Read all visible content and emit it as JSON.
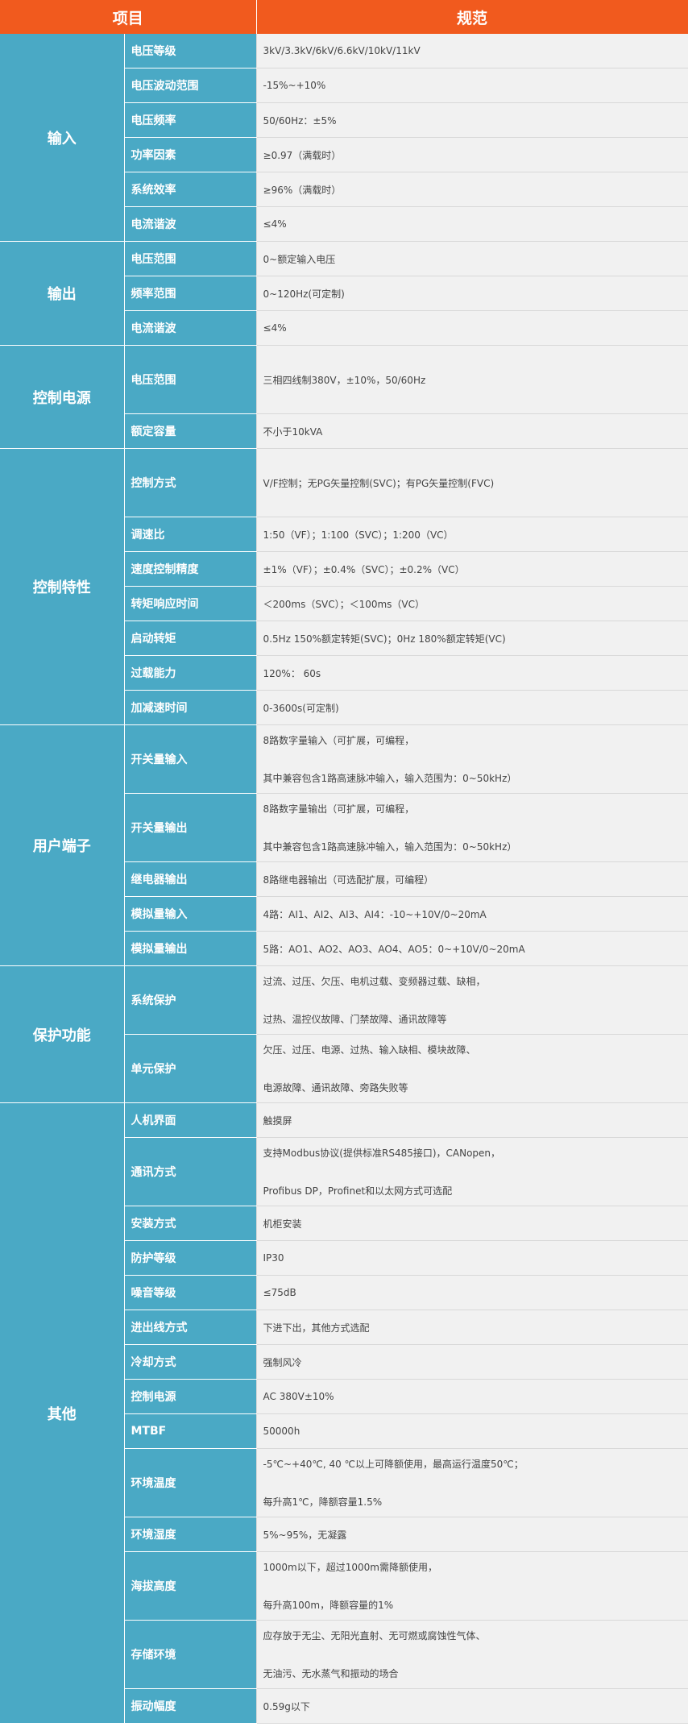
{
  "header": {
    "item": "项目",
    "spec": "规范"
  },
  "groups": [
    {
      "name": "输入",
      "rows": [
        {
          "item": "电压等级",
          "lines": [
            "3kV/3.3kV/6kV/6.6kV/10kV/11kV"
          ]
        },
        {
          "item": "电压波动范围",
          "lines": [
            "-15%~+10%"
          ]
        },
        {
          "item": "电压频率",
          "lines": [
            "50/60Hz：±5%"
          ]
        },
        {
          "item": "功率因素",
          "lines": [
            "≥0.97（满载时）"
          ]
        },
        {
          "item": "系统效率",
          "lines": [
            "≥96%（满载时）"
          ]
        },
        {
          "item": "电流谐波",
          "lines": [
            "≤4%"
          ]
        }
      ]
    },
    {
      "name": "输出",
      "rows": [
        {
          "item": "电压范围",
          "lines": [
            "0~额定输入电压"
          ]
        },
        {
          "item": "频率范围",
          "lines": [
            "0~120Hz(可定制)"
          ]
        },
        {
          "item": "电流谐波",
          "lines": [
            "≤4%"
          ]
        }
      ]
    },
    {
      "name": "控制电源",
      "rows": [
        {
          "item": "电压范围",
          "lines": [
            "三相四线制380V，±10%，50/60Hz"
          ],
          "tall": true
        },
        {
          "item": "额定容量",
          "lines": [
            "不小于10kVA"
          ]
        }
      ]
    },
    {
      "name": "控制特性",
      "rows": [
        {
          "item": "控制方式",
          "lines": [
            "V/F控制；无PG矢量控制(SVC)；有PG矢量控制(FVC)"
          ],
          "tall": true
        },
        {
          "item": "调速比",
          "lines": [
            "1:50（VF）；1:100（SVC）；1:200（VC）"
          ]
        },
        {
          "item": "速度控制精度",
          "lines": [
            "±1%（VF）；±0.4%（SVC）；±0.2%（VC）"
          ]
        },
        {
          "item": "转矩响应时间",
          "lines": [
            "＜200ms（SVC）；＜100ms（VC）"
          ]
        },
        {
          "item": "启动转矩",
          "lines": [
            "0.5Hz 150%额定转矩(SVC)；0Hz 180%额定转矩(VC)"
          ]
        },
        {
          "item": "过载能力",
          "lines": [
            "120%： 60s"
          ]
        },
        {
          "item": "加减速时间",
          "lines": [
            "0-3600s(可定制)"
          ]
        }
      ]
    },
    {
      "name": "用户端子",
      "rows": [
        {
          "item": "开关量输入",
          "lines": [
            "8路数字量输入（可扩展，可编程，",
            "其中兼容包含1路高速脉冲输入，输入范围为：0~50kHz）"
          ]
        },
        {
          "item": "开关量输出",
          "lines": [
            "8路数字量输出（可扩展，可编程，",
            "其中兼容包含1路高速脉冲输入，输入范围为：0~50kHz）"
          ]
        },
        {
          "item": "继电器输出",
          "lines": [
            "8路继电器输出（可选配扩展，可编程）"
          ]
        },
        {
          "item": "模拟量输入",
          "lines": [
            "4路：AI1、AI2、AI3、AI4：-10~+10V/0~20mA"
          ]
        },
        {
          "item": "模拟量输出",
          "lines": [
            "5路：AO1、AO2、AO3、AO4、AO5：0~+10V/0~20mA"
          ]
        }
      ]
    },
    {
      "name": "保护功能",
      "rows": [
        {
          "item": "系统保护",
          "lines": [
            "过流、过压、欠压、电机过载、变频器过载、缺相，",
            "过热、温控仪故障、门禁故障、通讯故障等"
          ]
        },
        {
          "item": "单元保护",
          "lines": [
            "欠压、过压、电源、过热、输入缺相、模块故障、",
            "电源故障、通讯故障、旁路失败等"
          ]
        }
      ]
    },
    {
      "name": "其他",
      "rows": [
        {
          "item": "人机界面",
          "lines": [
            "触摸屏"
          ]
        },
        {
          "item": "通讯方式",
          "lines": [
            "支持Modbus协议(提供标准RS485接口)，CANopen，",
            "Profibus DP，Profinet和以太网方式可选配"
          ]
        },
        {
          "item": "安装方式",
          "lines": [
            "机柜安装"
          ]
        },
        {
          "item": "防护等级",
          "lines": [
            "IP30"
          ]
        },
        {
          "item": "噪音等级",
          "lines": [
            "≤75dB"
          ]
        },
        {
          "item": "进出线方式",
          "lines": [
            "下进下出，其他方式选配"
          ]
        },
        {
          "item": "冷却方式",
          "lines": [
            "强制风冷"
          ]
        },
        {
          "item": "控制电源",
          "lines": [
            "AC 380V±10%"
          ]
        },
        {
          "item": "MTBF",
          "lines": [
            "50000h"
          ]
        },
        {
          "item": "环境温度",
          "lines": [
            " -5℃~+40℃, 40 ℃以上可降额使用，最高运行温度50℃；",
            "每升高1℃，降额容量1.5%"
          ]
        },
        {
          "item": "环境湿度",
          "lines": [
            "5%~95%，无凝露"
          ]
        },
        {
          "item": "海拔高度",
          "lines": [
            "1000m以下，超过1000m需降额使用，",
            "每升高100m，降额容量的1%"
          ]
        },
        {
          "item": "存储环境",
          "lines": [
            "应存放于无尘、无阳光直射、无可燃或腐蚀性气体、",
            "无油污、无水蒸气和振动的场合"
          ]
        },
        {
          "item": "振动幅度",
          "lines": [
            "0.59g以下"
          ]
        }
      ]
    }
  ]
}
